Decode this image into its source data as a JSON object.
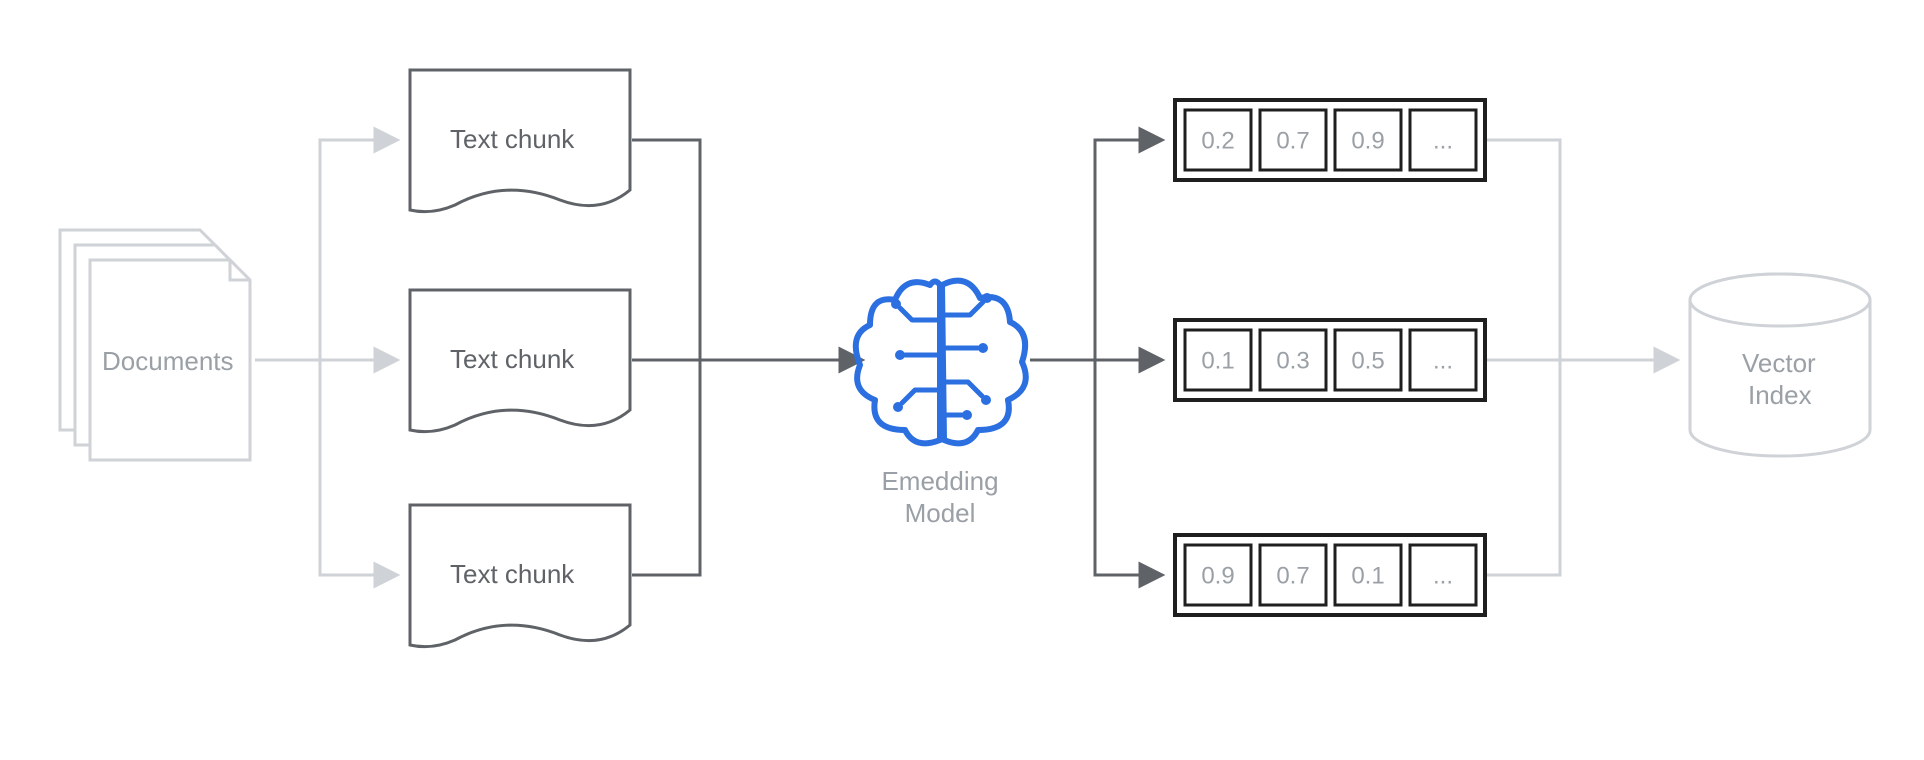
{
  "documents_label": "Documents",
  "chunks": {
    "top": "Text chunk",
    "mid": "Text chunk",
    "bot": "Text chunk"
  },
  "model_caption_line1": "Emedding",
  "model_caption_line2": "Model",
  "vectors": {
    "row1": [
      "0.2",
      "0.7",
      "0.9",
      "..."
    ],
    "row2": [
      "0.1",
      "0.3",
      "0.5",
      "..."
    ],
    "row3": [
      "0.9",
      "0.7",
      "0.1",
      "..."
    ]
  },
  "index_label_line1": "Vector",
  "index_label_line2": "Index",
  "colors": {
    "gray": "#cfd2d6",
    "dark_gray": "#5f6368",
    "text_gray": "#9aa0a6",
    "black": "#1f1f1f",
    "blue": "#2b6fe0"
  }
}
